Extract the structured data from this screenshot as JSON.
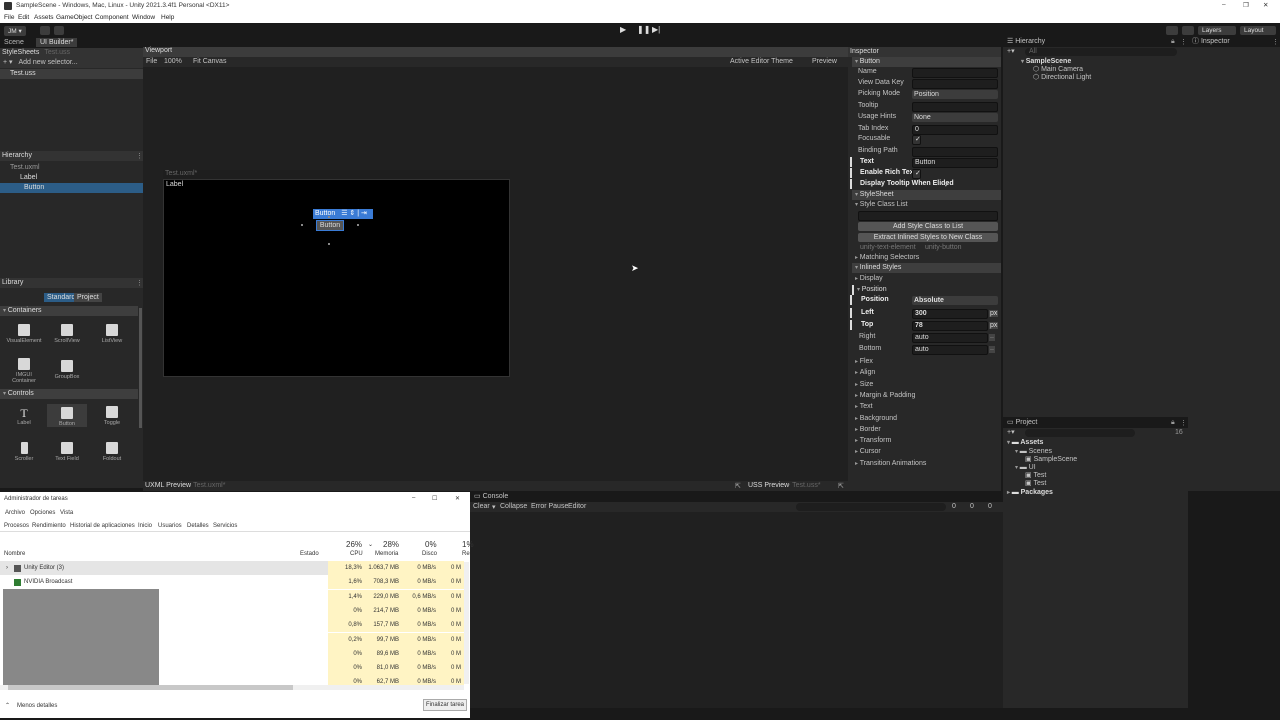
{
  "window": {
    "title": "SampleScene - Windows, Mac, Linux - Unity 2021.3.4f1 Personal <DX11>",
    "minimize": "–",
    "maximize": "❐",
    "close": "✕"
  },
  "menu": [
    "File",
    "Edit",
    "Assets",
    "GameObject",
    "Component",
    "Window",
    "Help"
  ],
  "toolbar": {
    "account": "JM ▾",
    "layers": "Layers",
    "layout": "Layout"
  },
  "tabs": {
    "scene": "Scene",
    "uibuilder": "UI Builder*"
  },
  "stylesheets": {
    "header": "StyleSheets",
    "file_hint": "Test.uss",
    "add_selector": "Add new selector...",
    "item": "Test.uss"
  },
  "hierarchy_left": {
    "header": "Hierarchy",
    "items": [
      "Test.uxml",
      "Label",
      "Button"
    ]
  },
  "library": {
    "header": "Library",
    "tab_standard": "Standard",
    "tab_project": "Project",
    "containers": "Containers",
    "controls": "Controls",
    "container_items": [
      "VisualElement",
      "ScrollView",
      "ListView",
      "IMGUI Container",
      "GroupBox"
    ],
    "control_items": [
      "Label",
      "Button",
      "Toggle",
      "Scroller",
      "Text Field",
      "Foldout"
    ]
  },
  "viewport": {
    "title": "Viewport",
    "file": "File",
    "zoom": "100%",
    "fit": "Fit Canvas",
    "theme": "Active Editor Theme",
    "preview": "Preview",
    "canvas_title": "Test.uxml*",
    "label": "Label",
    "button_tag": "Button",
    "button": "Button"
  },
  "preview_bar": {
    "uxml": "UXML Preview",
    "uxml_file": "- Test.uxml*",
    "uss": "USS Preview",
    "uss_file": "- Test.uss*"
  },
  "inspector": {
    "header": "Inspector",
    "section_button": "Button",
    "fields": [
      {
        "label": "Name",
        "value": ""
      },
      {
        "label": "View Data Key",
        "value": ""
      },
      {
        "label": "Picking Mode",
        "value": "Position"
      },
      {
        "label": "Tooltip",
        "value": ""
      },
      {
        "label": "Usage Hints",
        "value": "None"
      },
      {
        "label": "Tab Index",
        "value": "0"
      },
      {
        "label": "Focusable",
        "value": "✓"
      },
      {
        "label": "Binding Path",
        "value": ""
      },
      {
        "label": "Text",
        "value": "Button"
      },
      {
        "label": "Enable Rich Text",
        "value": "✓"
      },
      {
        "label": "Display Tooltip When Elided",
        "value": "✓"
      }
    ],
    "stylesheet": "StyleSheet",
    "style_class_list": "Style Class List",
    "add_class": "Add Style Class to List",
    "extract": "Extract Inlined Styles to New Class",
    "classes": [
      "unity-text-element",
      "unity-button"
    ],
    "matching": "Matching Selectors",
    "inlined": "Inlined Styles",
    "display": "Display",
    "position": "Position",
    "pos_fields": [
      {
        "label": "Position",
        "value": "Absolute"
      },
      {
        "label": "Left",
        "value": "300",
        "unit": "px"
      },
      {
        "label": "Top",
        "value": "78",
        "unit": "px"
      },
      {
        "label": "Right",
        "value": "auto"
      },
      {
        "label": "Bottom",
        "value": "auto"
      }
    ],
    "more": [
      "Flex",
      "Align",
      "Size",
      "Margin & Padding",
      "Text",
      "Background",
      "Border",
      "Transform",
      "Cursor",
      "Transition Animations"
    ]
  },
  "hierarchy": {
    "header": "Hierarchy",
    "search": "All",
    "scene": "SampleScene",
    "items": [
      "Main Camera",
      "Directional Light"
    ]
  },
  "inspector_tab": "Inspector",
  "project": {
    "header": "Project",
    "assets": "Assets",
    "scenes": "Scenes",
    "sample": "SampleScene",
    "ui": "UI",
    "test1": "Test",
    "test2": "Test",
    "packages": "Packages",
    "count": "16"
  },
  "console": {
    "header": "Console",
    "clear": "Clear",
    "collapse": "Collapse",
    "error_pause": "Error Pause",
    "editor": "Editor",
    "c1": "0",
    "c2": "0",
    "c3": "0"
  },
  "taskmgr": {
    "title": "Administrador de tareas",
    "menu": [
      "Archivo",
      "Opciones",
      "Vista"
    ],
    "tabs": [
      "Procesos",
      "Rendimiento",
      "Historial de aplicaciones",
      "Inicio",
      "Usuarios",
      "Detalles",
      "Servicios"
    ],
    "cols": {
      "name": "Nombre",
      "status": "Estado",
      "cpu_pct": "26%",
      "cpu": "CPU",
      "mem_pct": "28%",
      "mem": "Memoria",
      "disk_pct": "0%",
      "disk": "Disco",
      "net_pct": "1%",
      "net": "Re"
    },
    "rows": [
      {
        "name": "Unity Editor (3)",
        "cpu": "18,3%",
        "mem": "1.063,7 MB",
        "disk": "0 MB/s",
        "net": "0 M"
      },
      {
        "name": "NVIDIA Broadcast",
        "cpu": "1,6%",
        "mem": "708,3 MB",
        "disk": "0 MB/s",
        "net": "0 M"
      },
      {
        "name": "",
        "cpu": "1,4%",
        "mem": "229,0 MB",
        "disk": "0,6 MB/s",
        "net": "0 M"
      },
      {
        "name": "",
        "cpu": "0%",
        "mem": "214,7 MB",
        "disk": "0 MB/s",
        "net": "0 M"
      },
      {
        "name": "",
        "cpu": "0,8%",
        "mem": "157,7 MB",
        "disk": "0 MB/s",
        "net": "0 M"
      },
      {
        "name": "",
        "cpu": "0,2%",
        "mem": "99,7 MB",
        "disk": "0 MB/s",
        "net": "0 M"
      },
      {
        "name": "",
        "cpu": "0%",
        "mem": "89,6 MB",
        "disk": "0 MB/s",
        "net": "0 M"
      },
      {
        "name": "",
        "cpu": "0%",
        "mem": "81,0 MB",
        "disk": "0 MB/s",
        "net": "0 M"
      },
      {
        "name": "",
        "cpu": "0%",
        "mem": "62,7 MB",
        "disk": "0 MB/s",
        "net": "0 M"
      }
    ],
    "fewer": "Menos detalles",
    "end": "Finalizar tarea"
  }
}
